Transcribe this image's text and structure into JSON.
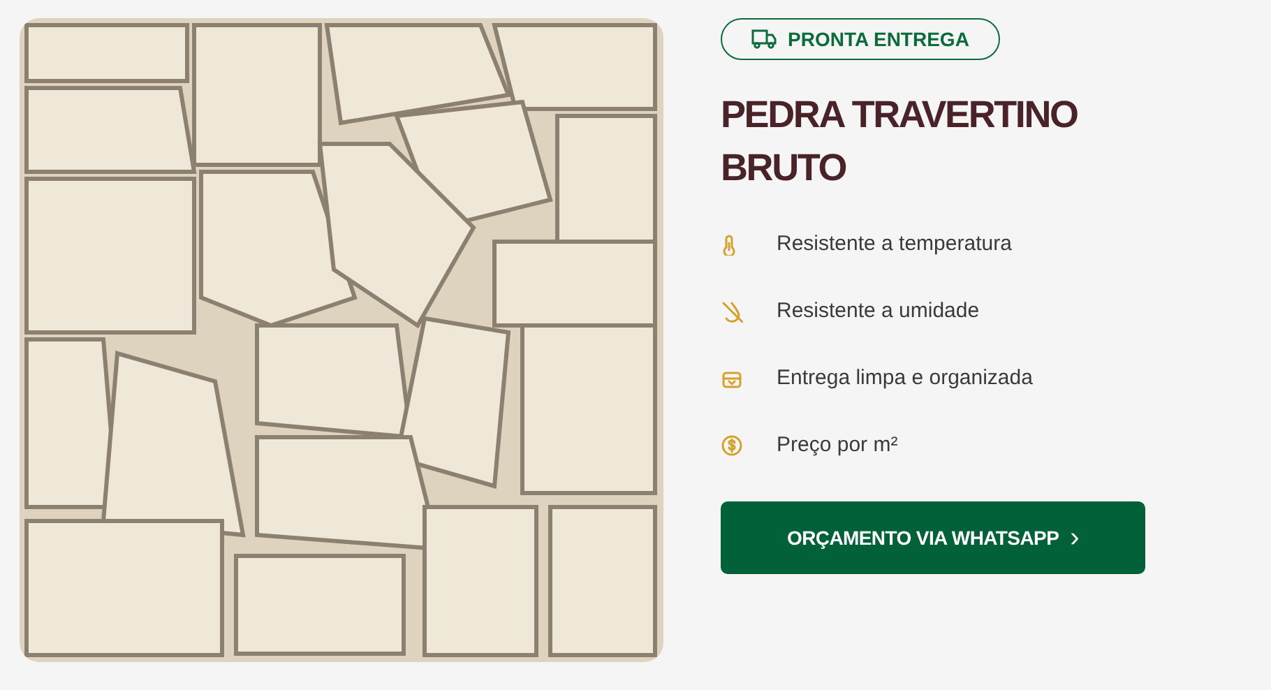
{
  "badge": {
    "label": "PRONTA ENTREGA"
  },
  "product": {
    "title": "PEDRA TRAVERTINO BRUTO"
  },
  "features": [
    {
      "kind": "thermometer",
      "label": "Resistente a temperatura"
    },
    {
      "kind": "humidity",
      "label": "Resistente a umidade"
    },
    {
      "kind": "box",
      "label": "Entrega limpa e organizada"
    },
    {
      "kind": "money",
      "label": "Preço por m²"
    }
  ],
  "cta": {
    "label": "ORÇAMENTO VIA WHATSAPP",
    "arrow": "›"
  }
}
